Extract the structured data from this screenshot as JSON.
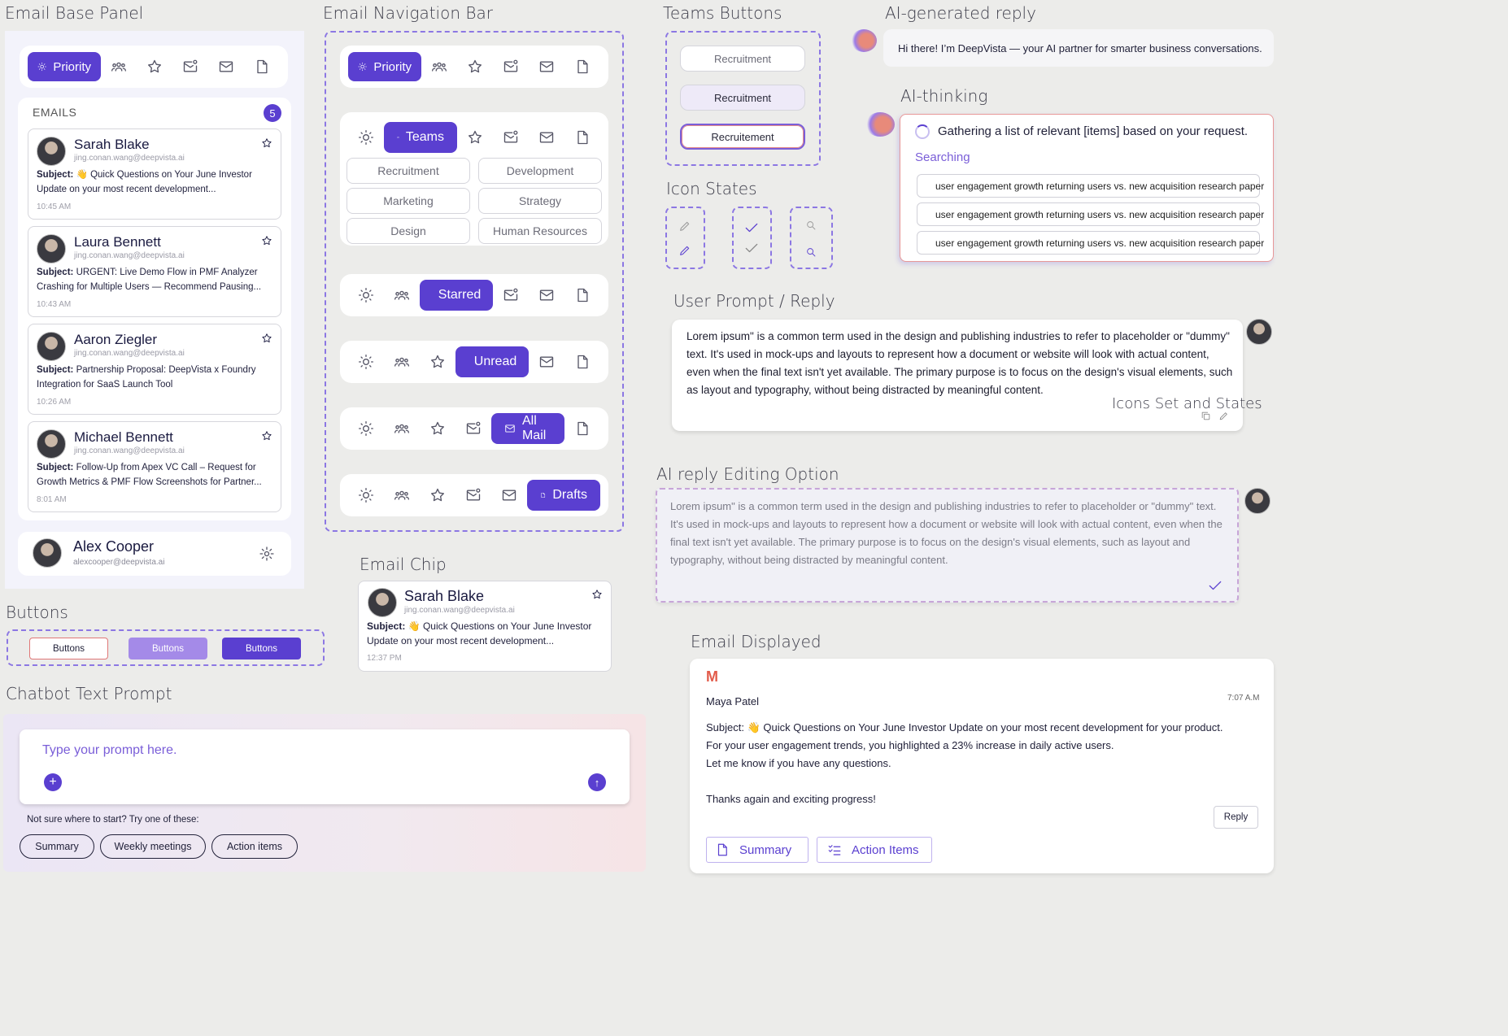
{
  "titles": {
    "email_base_panel": "Email Base Panel",
    "email_nav_bar": "Email Navigation Bar",
    "teams_buttons": "Teams Buttons",
    "ai_reply": "AI-generated reply",
    "ai_thinking": "AI-thinking",
    "icon_states": "Icon States",
    "user_prompt": "User Prompt / Reply",
    "icons_set": "Icons Set and States",
    "ai_editing": "AI reply Editing Option",
    "email_chip": "Email Chip",
    "buttons": "Buttons",
    "chatbot": "Chatbot Text Prompt",
    "email_displayed": "Email Displayed"
  },
  "nav": {
    "priority": "Priority",
    "teams": "Teams",
    "starred": "Starred",
    "unread": "Unread",
    "all_mail": "All Mail",
    "drafts": "Drafts"
  },
  "panel": {
    "emails_label": "EMAILS",
    "count": "5",
    "emails": [
      {
        "name": "Sarah Blake",
        "addr": "jing.conan.wang@deepvista.ai",
        "subject_label": "Subject:",
        "subject": " 👋 Quick Questions on Your June Investor Update on your most recent development...",
        "time": "10:45 AM"
      },
      {
        "name": "Laura Bennett",
        "addr": "jing.conan.wang@deepvista.ai",
        "subject_label": "Subject:",
        "subject": " URGENT: Live Demo Flow in PMF Analyzer Crashing for Multiple Users — Recommend Pausing...",
        "time": "10:43 AM"
      },
      {
        "name": "Aaron Ziegler",
        "addr": "jing.conan.wang@deepvista.ai",
        "subject_label": "Subject:",
        "subject": " Partnership Proposal: DeepVista x Foundry Integration for SaaS Launch Tool",
        "time": "10:26 AM"
      },
      {
        "name": "Michael Bennett",
        "addr": "jing.conan.wang@deepvista.ai",
        "subject_label": "Subject:",
        "subject": " Follow-Up from Apex VC Call – Request for Growth Metrics & PMF Flow Screenshots for Partner...",
        "time": "8:01 AM"
      }
    ],
    "user": {
      "name": "Alex Cooper",
      "addr": "alexcooper@deepvista.ai"
    }
  },
  "teams": [
    "Recruitment",
    "Development",
    "Marketing",
    "Strategy",
    "Design",
    "Human Resources"
  ],
  "team_buttons": [
    "Recruitment",
    "Recruitment",
    "Recruitement"
  ],
  "ai": {
    "reply": "Hi there! I’m DeepVista — your AI partner for smarter business conversations.",
    "thinking": "Gathering a list of relevant [items] based on your request.",
    "searching": "Searching",
    "queries": [
      "user engagement growth returning users vs. new acquisition research paper",
      "user engagement growth returning users vs. new acquisition research paper",
      "user engagement growth returning users vs. new acquisition research paper"
    ]
  },
  "lorem": "Lorem ipsum\" is a common term used in the design and publishing industries to refer to placeholder or \"dummy\" text. It's used in mock-ups and layouts to represent how a document or website will look with actual content, even when the final text isn't yet available. The primary purpose is to focus on the design's visual elements, such as layout and typography, without being distracted by meaningful content.",
  "chip": {
    "name": "Sarah Blake",
    "addr": "jing.conan.wang@deepvista.ai",
    "subject_label": "Subject:",
    "subject": " 👋 Quick Questions on Your June Investor Update on your most recent development...",
    "time": "12:37 PM"
  },
  "buttons": [
    "Buttons",
    "Buttons",
    "Buttons"
  ],
  "chatbot": {
    "placeholder": "Type your prompt here.",
    "hint": "Not sure where to start? Try one of these:",
    "suggestions": [
      "Summary",
      "Weekly meetings",
      "Action items"
    ]
  },
  "displayed": {
    "sender": "Maya Patel",
    "time": "7:07 A.M",
    "subject": "Subject: 👋 Quick Questions on Your June Investor Update on your most recent development for your product.",
    "line1": "For your user engagement trends, you highlighted a 23% increase in daily active users.",
    "line2": "Let me know if you have any questions.",
    "line3": "Thanks again and exciting progress!",
    "reply": "Reply",
    "summary": "Summary",
    "action_items": "Action Items"
  },
  "colors": {
    "accent": "#5a3fd0",
    "accent_light": "#a48ae8",
    "dash": "#8c77e3"
  }
}
